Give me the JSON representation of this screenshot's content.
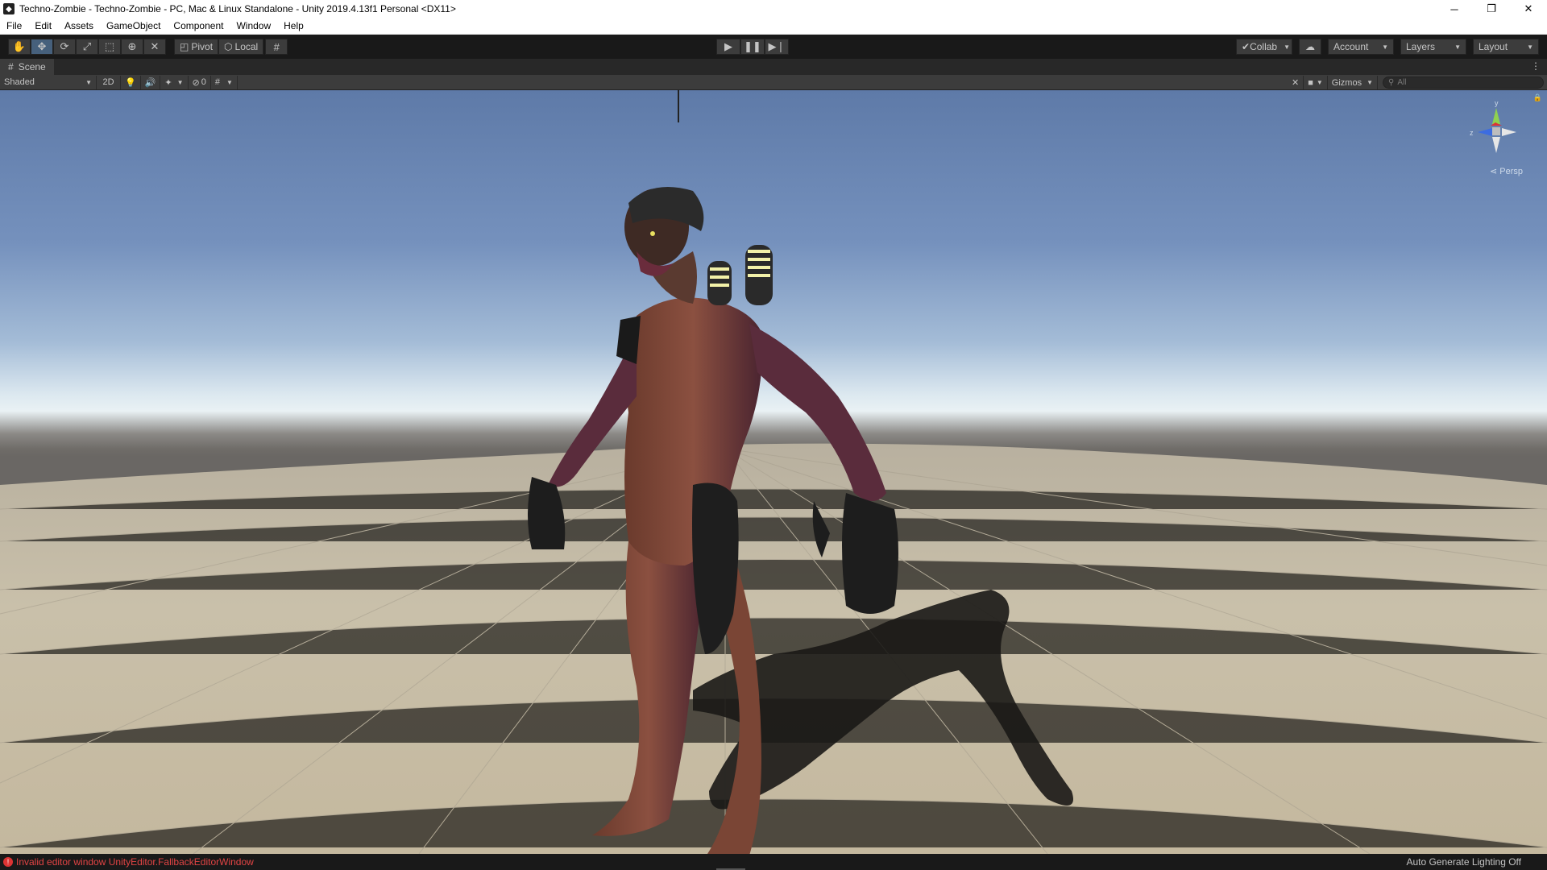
{
  "window": {
    "title": "Techno-Zombie - Techno-Zombie - PC, Mac & Linux Standalone - Unity 2019.4.13f1 Personal <DX11>",
    "minimize": "─",
    "restore": "❐",
    "close": "✕"
  },
  "menu": [
    "File",
    "Edit",
    "Assets",
    "GameObject",
    "Component",
    "Window",
    "Help"
  ],
  "toolbar": {
    "pivot_label": "Pivot",
    "local_label": "Local",
    "collab_label": "Collab",
    "account_label": "Account",
    "layers_label": "Layers",
    "layout_label": "Layout"
  },
  "scene_tab": {
    "label": "Scene"
  },
  "scene_toolbar": {
    "shading_mode": "Shaded",
    "mode_2d": "2D",
    "hidden_count": "0",
    "gizmos_label": "Gizmos",
    "search_placeholder": "All"
  },
  "viewport": {
    "projection_label": "Persp",
    "axis_y": "y",
    "axis_z": "z",
    "sky_color": "#6d8ab8",
    "floor_color": "#c6bca6"
  },
  "status": {
    "error_message": "Invalid editor window UnityEditor.FallbackEditorWindow",
    "lighting": "Auto Generate Lighting Off"
  },
  "colors": {
    "accent_active": "#46607c",
    "error": "#e24444"
  }
}
